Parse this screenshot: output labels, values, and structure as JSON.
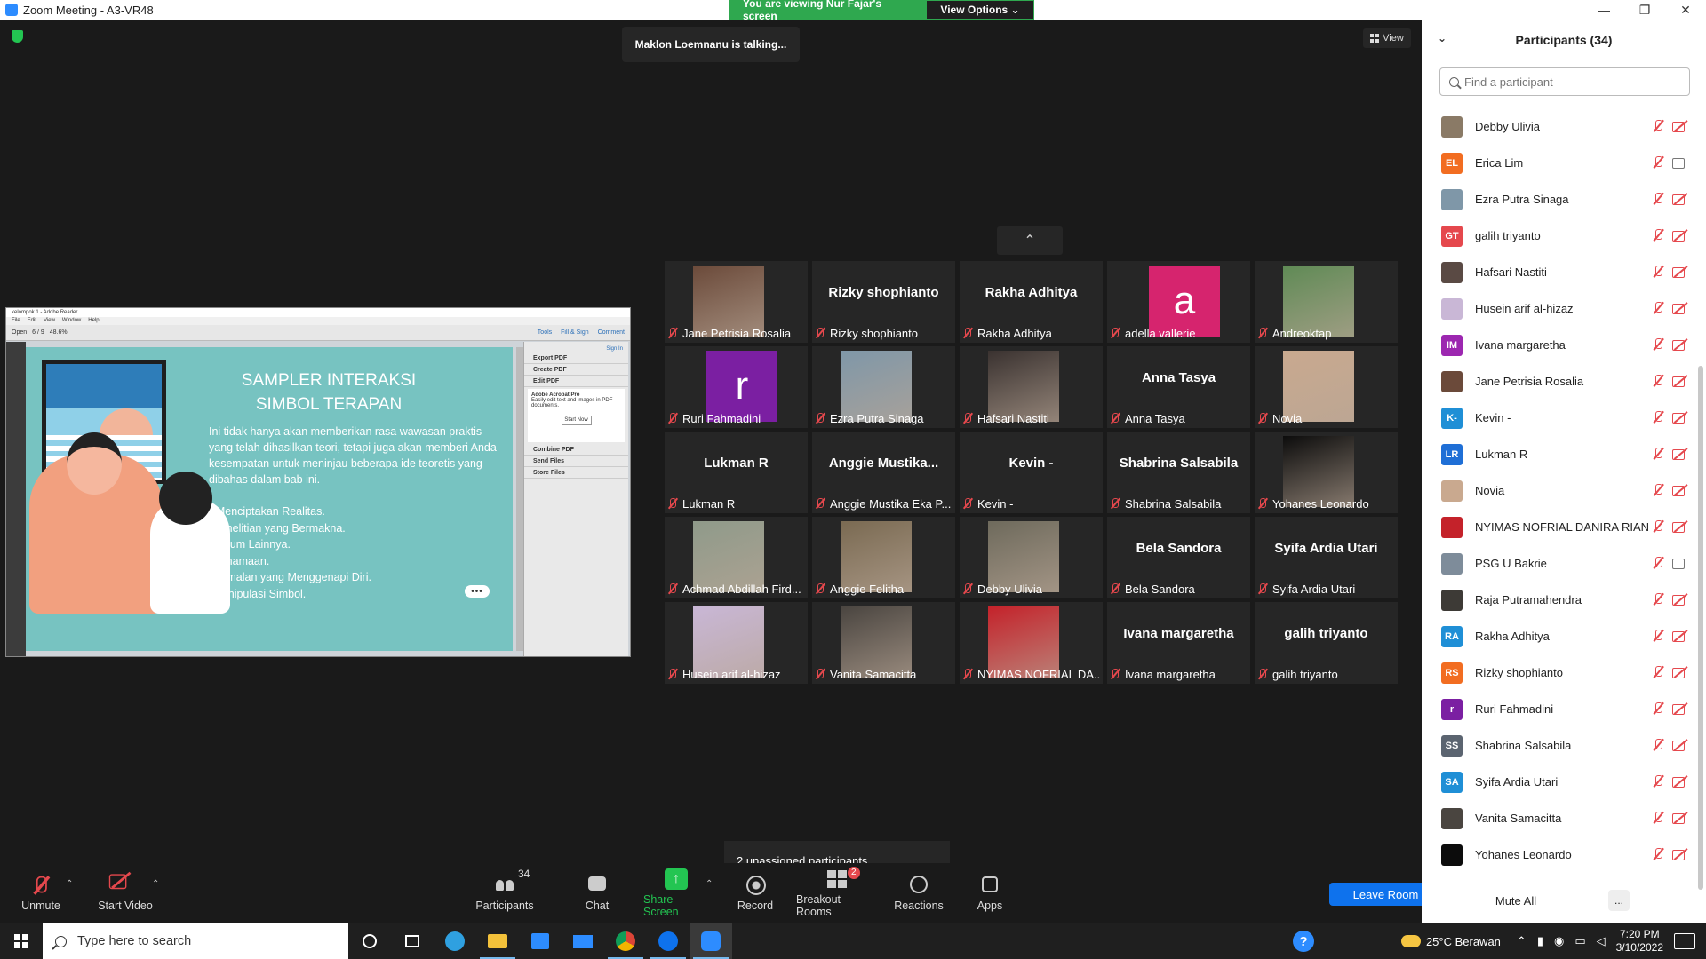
{
  "window": {
    "title": "Zoom Meeting - A3-VR48",
    "minimize": "—",
    "restore": "❐",
    "close": "✕"
  },
  "banner": {
    "viewing": "You are viewing Nur Fajar's screen",
    "view_options": "View Options ⌄"
  },
  "meeting": {
    "talking": "Maklon Loemnanu is talking...",
    "view_label": "View",
    "collapse": "⌃",
    "unassigned": "2 unassigned participants"
  },
  "share": {
    "app_title": "kelompok 1 - Adobe Reader",
    "menu": [
      "File",
      "Edit",
      "View",
      "Window",
      "Help"
    ],
    "toolbar_open": "Open",
    "toolbar_page": "6 / 9",
    "toolbar_zoom": "48.6%",
    "toolbar_tools": "Tools",
    "toolbar_fill": "Fill & Sign",
    "toolbar_comment": "Comment",
    "sign_in": "Sign In",
    "right_items": [
      "Export PDF",
      "Create PDF",
      "Edit PDF"
    ],
    "pro_title": "Adobe Acrobat Pro",
    "pro_text": "Easily edit text and images in PDF documents.",
    "pro_button": "Start Now",
    "right_items2": [
      "Combine PDF",
      "Send Files",
      "Store Files"
    ],
    "slide_title": "SAMPLER INTERAKSI SIMBOL TERAPAN",
    "slide_para": "Ini tidak hanya akan memberikan rasa wawasan praktis yang telah dihasilkan teori, tetapi juga akan memberi Anda kesempatan untuk meninjau beberapa ide teoretis yang dibahas dalam bab ini.",
    "slide_bullets": [
      "• Menciptakan Realitas.",
      "•Penelitian yang Bermakna.",
      "•Umum Lainnya.",
      "•Penamaan.",
      "•Ramalan yang Menggenapi Diri.",
      "•Manipulasi Simbol."
    ],
    "more": "•••"
  },
  "tiles": [
    {
      "name": "Jane Petrisia Rosalia",
      "kind": "photo",
      "color": "#6b4a3a"
    },
    {
      "name": "Rizky shophianto",
      "kind": "name",
      "big": "Rizky shophianto"
    },
    {
      "name": "Rakha Adhitya",
      "kind": "name",
      "big": "Rakha Adhitya"
    },
    {
      "name": "adella vallerie",
      "kind": "letter",
      "letter": "a",
      "color": "#d6246e"
    },
    {
      "name": "Andreoktap",
      "kind": "photo",
      "color": "#5f8a55"
    },
    {
      "name": "Ruri Fahmadini",
      "kind": "letter",
      "letter": "r",
      "color": "#7b1fa2"
    },
    {
      "name": "Ezra Putra Sinaga",
      "kind": "photo",
      "color": "#7f97a8"
    },
    {
      "name": "Hafsari Nastiti",
      "kind": "photo",
      "color": "#3a3230"
    },
    {
      "name": "Anna Tasya",
      "kind": "name",
      "big": "Anna Tasya"
    },
    {
      "name": "Novia",
      "kind": "photo",
      "color": "#c9a98f"
    },
    {
      "name": "Lukman R",
      "kind": "name",
      "big": "Lukman R"
    },
    {
      "name": "Anggie Mustika Eka P...",
      "kind": "name",
      "big": "Anggie  Mustika..."
    },
    {
      "name": "Kevin -",
      "kind": "name",
      "big": "Kevin -"
    },
    {
      "name": "Shabrina Salsabila",
      "kind": "name",
      "big": "Shabrina Salsabila"
    },
    {
      "name": "Yohanes Leonardo",
      "kind": "photo",
      "color": "#0c0c0c"
    },
    {
      "name": "Achmad Abdillah Fird...",
      "kind": "photo",
      "color": "#8f9a8a"
    },
    {
      "name": "Anggie Felitha",
      "kind": "photo",
      "color": "#7a6a52"
    },
    {
      "name": "Debby Ulivia",
      "kind": "photo",
      "color": "#6e6a5c"
    },
    {
      "name": "Bela Sandora",
      "kind": "name",
      "big": "Bela Sandora"
    },
    {
      "name": "Syifa Ardia Utari",
      "kind": "name",
      "big": "Syifa Ardia Utari"
    },
    {
      "name": "Husein arif al-hizaz",
      "kind": "photo",
      "color": "#c9b7d6"
    },
    {
      "name": "Vanita Samacitta",
      "kind": "photo",
      "color": "#4a4540"
    },
    {
      "name": "NYIMAS NOFRIAL DA...",
      "kind": "photo",
      "color": "#c4222a"
    },
    {
      "name": "Ivana margaretha",
      "kind": "name",
      "big": "Ivana margaretha"
    },
    {
      "name": "galih triyanto",
      "kind": "name",
      "big": "galih triyanto"
    }
  ],
  "controls": {
    "unmute": "Unmute",
    "start_video": "Start Video",
    "participants": "Participants",
    "participants_count": "34",
    "chat": "Chat",
    "share_screen": "Share Screen",
    "record": "Record",
    "breakout": "Breakout Rooms",
    "breakout_badge": "2",
    "reactions": "Reactions",
    "apps": "Apps",
    "leave": "Leave Room",
    "caret": "⌃"
  },
  "panel": {
    "title": "Participants (34)",
    "chevron": "⌄",
    "search_placeholder": "Find a participant",
    "mute_all": "Mute All",
    "more": "...",
    "people": [
      {
        "name": "Debby Ulivia",
        "initials": "",
        "color": "#8a7a66",
        "cam": "off"
      },
      {
        "name": "Erica Lim",
        "initials": "EL",
        "color": "#f26d21",
        "cam": "on"
      },
      {
        "name": "Ezra Putra Sinaga",
        "initials": "",
        "color": "#7f97a8",
        "cam": "off"
      },
      {
        "name": "galih triyanto",
        "initials": "GT",
        "color": "#e5484d",
        "cam": "off"
      },
      {
        "name": "Hafsari Nastiti",
        "initials": "",
        "color": "#5a4a44",
        "cam": "off"
      },
      {
        "name": "Husein arif al-hizaz",
        "initials": "",
        "color": "#c9b7d6",
        "cam": "off"
      },
      {
        "name": "Ivana margaretha",
        "initials": "IM",
        "color": "#9c27b0",
        "cam": "off"
      },
      {
        "name": "Jane Petrisia Rosalia",
        "initials": "",
        "color": "#6b4a3a",
        "cam": "off"
      },
      {
        "name": "Kevin -",
        "initials": "K-",
        "color": "#1f8fd6",
        "cam": "off"
      },
      {
        "name": "Lukman R",
        "initials": "LR",
        "color": "#1f6fd6",
        "cam": "off"
      },
      {
        "name": "Novia",
        "initials": "",
        "color": "#c9a98f",
        "cam": "off"
      },
      {
        "name": "NYIMAS NOFRIAL DANIRA RIAN",
        "initials": "",
        "color": "#c4222a",
        "cam": "off"
      },
      {
        "name": "PSG U Bakrie",
        "initials": "",
        "color": "#7e8c9a",
        "cam": "on"
      },
      {
        "name": "Raja Putramahendra",
        "initials": "",
        "color": "#3d3a36",
        "cam": "off"
      },
      {
        "name": "Rakha Adhitya",
        "initials": "RA",
        "color": "#1f8fd6",
        "cam": "off"
      },
      {
        "name": "Rizky shophianto",
        "initials": "RS",
        "color": "#f26d21",
        "cam": "off"
      },
      {
        "name": "Ruri Fahmadini",
        "initials": "r",
        "color": "#7b1fa2",
        "cam": "off"
      },
      {
        "name": "Shabrina Salsabila",
        "initials": "SS",
        "color": "#5b6470",
        "cam": "off"
      },
      {
        "name": "Syifa Ardia Utari",
        "initials": "SA",
        "color": "#1f8fd6",
        "cam": "off"
      },
      {
        "name": "Vanita Samacitta",
        "initials": "",
        "color": "#4a4540",
        "cam": "off"
      },
      {
        "name": "Yohanes Leonardo",
        "initials": "",
        "color": "#0c0c0c",
        "cam": "off"
      }
    ]
  },
  "taskbar": {
    "search_placeholder": "Type here to search",
    "weather": "25°C  Berawan",
    "time": "7:20 PM",
    "date": "3/10/2022",
    "help": "?"
  }
}
